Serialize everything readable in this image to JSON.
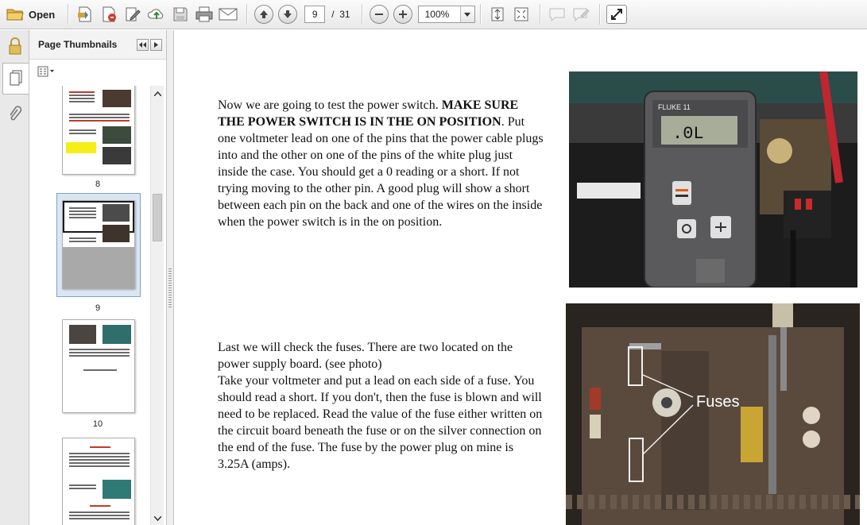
{
  "toolbar": {
    "open_label": "Open",
    "page_current": "9",
    "page_separator": "/",
    "page_total": "31",
    "zoom_value": "100%"
  },
  "thumbnails_panel": {
    "title": "Page Thumbnails",
    "pages": [
      {
        "label": "8",
        "selected": false
      },
      {
        "label": "9",
        "selected": true
      },
      {
        "label": "10",
        "selected": false
      },
      {
        "label": "",
        "selected": false
      }
    ]
  },
  "document": {
    "para1_intro": "Now we are going to test the power switch. ",
    "para1_bold": "MAKE SURE THE POWER SWITCH IS IN THE ON POSITION",
    "para1_rest": ".  Put one voltmeter lead on one of the pins that the power cable plugs into and the other on one of the pins of the white plug just inside the case. You should get a 0 reading or a short. If not trying moving to the other pin. A good plug will show a short between each pin on the back and one of the wires on the inside when the power switch is in the on position.",
    "para2": "Last we will check the fuses. There are two located on the power supply board. (see photo)\nTake your voltmeter and put a lead on each side of a fuse. You should read a short. If you don't, then the fuse is blown and will need to be replaced. Read the value of the fuse either written on the circuit board beneath the fuse or on the silver connection on the end of the fuse. The fuse by the power plug on mine is 3.25A (amps).",
    "photo1": {
      "meter_brand": "FLUKE 11",
      "meter_reading": ".0L"
    },
    "photo2": {
      "caption": "Fuses"
    }
  },
  "icons": [
    "open-folder-icon",
    "create-pdf-icon",
    "export-pdf-icon",
    "edit-icon",
    "upload-icon",
    "save-icon",
    "print-icon",
    "email-icon",
    "previous-page-icon",
    "next-page-icon",
    "zoom-out-icon",
    "zoom-in-icon",
    "fit-page-icon",
    "fit-width-icon",
    "comment-icon",
    "highlight-icon",
    "expand-icon",
    "lock-icon",
    "page-thumbnails-icon",
    "attachment-icon"
  ]
}
